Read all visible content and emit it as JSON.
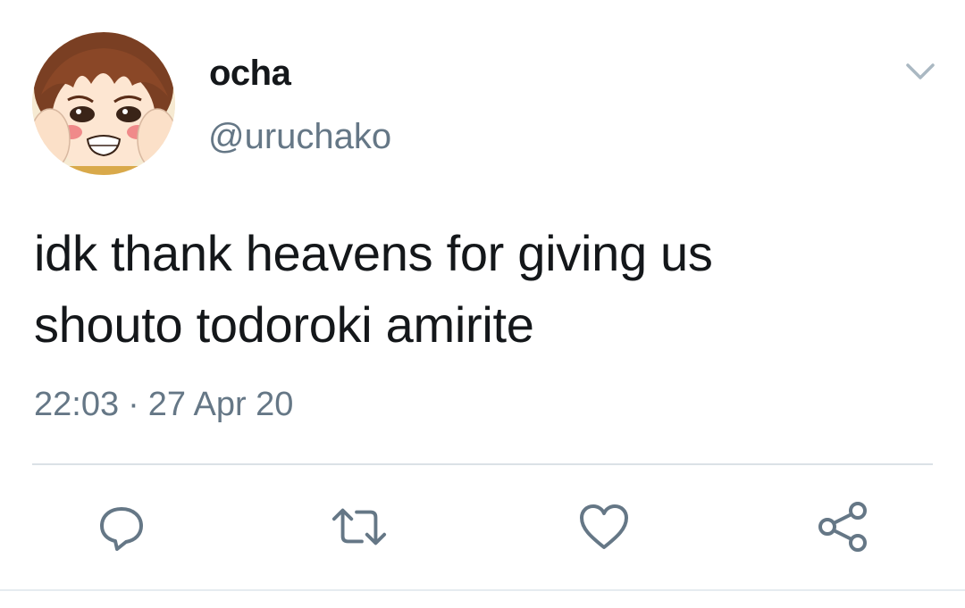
{
  "tweet": {
    "author": {
      "display_name": "ocha",
      "handle": "@uruchako",
      "avatar_icon": "anime-avatar"
    },
    "text": "idk thank heavens for giving us\nshouto todoroki amirite",
    "time": "22:03",
    "separator": "·",
    "date": "27 Apr 20",
    "menu_icon": "chevron-down-icon"
  },
  "actions": [
    {
      "name": "reply",
      "icon": "reply-icon"
    },
    {
      "name": "retweet",
      "icon": "retweet-icon"
    },
    {
      "name": "like",
      "icon": "heart-icon"
    },
    {
      "name": "share",
      "icon": "share-icon"
    }
  ],
  "colors": {
    "text": "#14171a",
    "secondary": "#657786",
    "divider": "#dbe1e6"
  }
}
